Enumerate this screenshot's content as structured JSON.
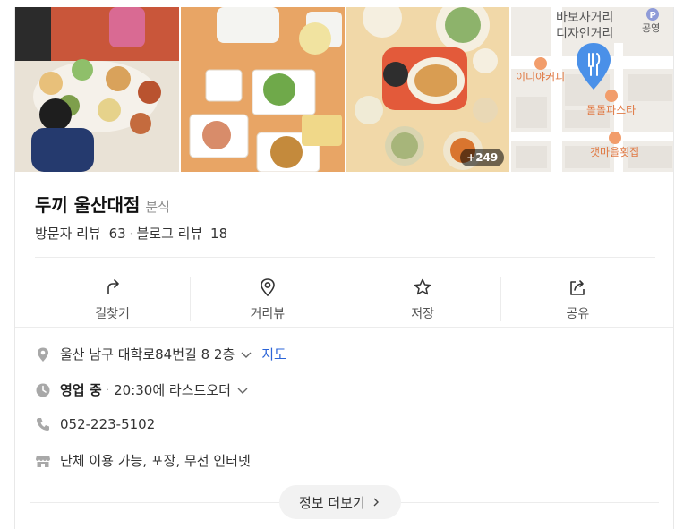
{
  "photos": {
    "more_count": "+249",
    "map_labels": {
      "street": "바보사거리",
      "district": "디자인거리",
      "parking_letter": "P",
      "parking_label": "공영",
      "cafe": "이디야커피",
      "pasta": "돌돌파스타",
      "raw_fish": "갯마을횟집"
    }
  },
  "place": {
    "name": "두끼 울산대점",
    "category": "분식",
    "visitor_review_label": "방문자 리뷰",
    "visitor_review_count": "63",
    "blog_review_label": "블로그 리뷰",
    "blog_review_count": "18"
  },
  "actions": {
    "directions": "길찾기",
    "street_view": "거리뷰",
    "save": "저장",
    "share": "공유"
  },
  "info": {
    "address": "울산 남구 대학로84번길 8 2층",
    "map_link": "지도",
    "status": "영업 중",
    "hours_note": "20:30에 라스트오더",
    "phone": "052-223-5102",
    "amenities": "단체 이용 가능, 포장, 무선 인터넷"
  },
  "more_info_label": "정보 더보기",
  "colors": {
    "accent_blue": "#2b64d8",
    "map_pin": "#4a90e8",
    "icon_gray": "#a8a8a8"
  }
}
